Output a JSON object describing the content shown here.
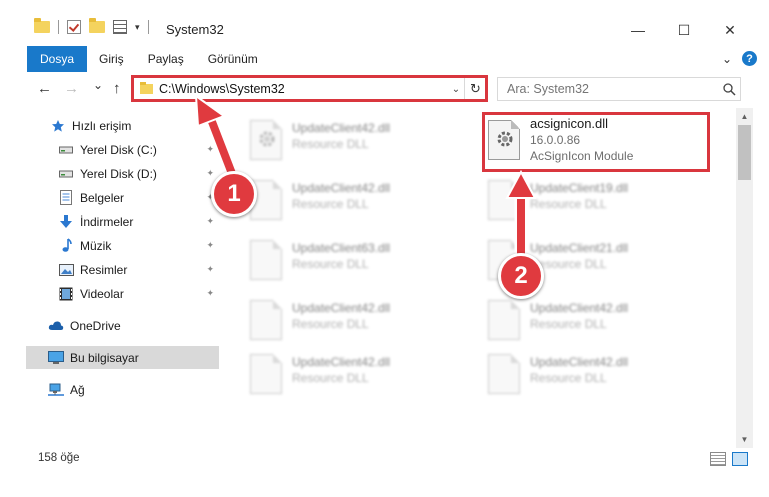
{
  "window": {
    "title": "System32",
    "minimize_glyph": "—",
    "maximize_glyph": "☐",
    "close_glyph": "✕"
  },
  "ribbon": {
    "tabs": [
      {
        "label": "Dosya",
        "active": true
      },
      {
        "label": "Giriş",
        "active": false
      },
      {
        "label": "Paylaş",
        "active": false
      },
      {
        "label": "Görünüm",
        "active": false
      }
    ],
    "help_glyph": "?",
    "expand_glyph": "⌄"
  },
  "navigation": {
    "back_glyph": "←",
    "forward_glyph": "→",
    "recent_glyph": "⌄",
    "up_glyph": "↑",
    "address": "C:\\Windows\\System32",
    "dropdown_glyph": "⌄",
    "refresh_glyph": "↻",
    "search_placeholder": "Ara: System32"
  },
  "sidebar": {
    "items": [
      {
        "label": "Hızlı erişim",
        "icon": "star-icon",
        "pinned": false,
        "selected": false
      },
      {
        "label": "Yerel Disk (C:)",
        "icon": "drive-icon",
        "pinned": true,
        "selected": false
      },
      {
        "label": "Yerel Disk (D:)",
        "icon": "drive-icon",
        "pinned": true,
        "selected": false
      },
      {
        "label": "Belgeler",
        "icon": "documents-icon",
        "pinned": true,
        "selected": false
      },
      {
        "label": "İndirmeler",
        "icon": "download-icon",
        "pinned": true,
        "selected": false
      },
      {
        "label": "Müzik",
        "icon": "music-icon",
        "pinned": true,
        "selected": false
      },
      {
        "label": "Resimler",
        "icon": "pictures-icon",
        "pinned": true,
        "selected": false
      },
      {
        "label": "Videolar",
        "icon": "video-icon",
        "pinned": true,
        "selected": false
      },
      {
        "label": "OneDrive",
        "icon": "cloud-icon",
        "pinned": false,
        "selected": false
      },
      {
        "label": "Bu bilgisayar",
        "icon": "computer-icon",
        "pinned": false,
        "selected": true
      },
      {
        "label": "Ağ",
        "icon": "network-icon",
        "pinned": false,
        "selected": false
      }
    ],
    "pin_glyph": "📌"
  },
  "files": [
    {
      "name": "UpdateClient42.dll",
      "type": "Resource DLL",
      "blurred": true
    },
    {
      "name": "acsignicon.dll",
      "version": "16.0.0.86",
      "type": "AcSignIcon Module",
      "blurred": false,
      "highlighted": true
    },
    {
      "name": "UpdateClient42.dll",
      "type": "Resource DLL",
      "blurred": true
    },
    {
      "name": "UpdateClient19.dll",
      "type": "Resource DLL",
      "blurred": true
    },
    {
      "name": "UpdateClient63.dll",
      "type": "Resource DLL",
      "blurred": true
    },
    {
      "name": "UpdateClient21.dll",
      "type": "Resource DLL",
      "blurred": true
    },
    {
      "name": "UpdateClient42.dll",
      "type": "Resource DLL",
      "blurred": true
    },
    {
      "name": "UpdateClient42.dll",
      "type": "Resource DLL",
      "blurred": true
    },
    {
      "name": "UpdateClient42.dll",
      "type": "Resource DLL",
      "blurred": true
    },
    {
      "name": "UpdateClient42.dll",
      "type": "Resource DLL",
      "blurred": true
    }
  ],
  "status": {
    "item_count": "158 öğe"
  },
  "annotations": {
    "badge_1": "1",
    "badge_2": "2",
    "highlight_color": "#d9363e"
  }
}
